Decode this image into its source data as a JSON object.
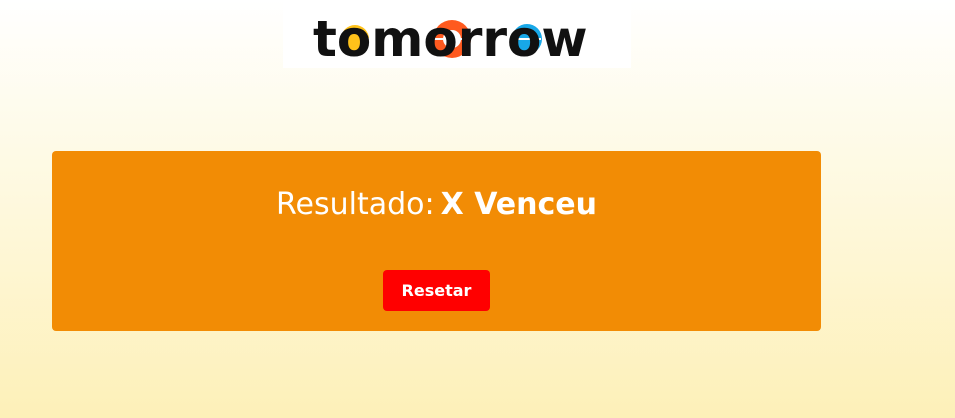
{
  "header": {
    "logo_text": "tomorrow"
  },
  "result": {
    "label": "Resultado:",
    "value": "X Venceu"
  },
  "actions": {
    "reset_label": "Resetar"
  },
  "colors": {
    "panel": "#f28c05",
    "button": "#ff0000",
    "logo_orange": "#ff5a1f",
    "logo_yellow": "#ffc21a",
    "logo_blue": "#18a8e8"
  }
}
